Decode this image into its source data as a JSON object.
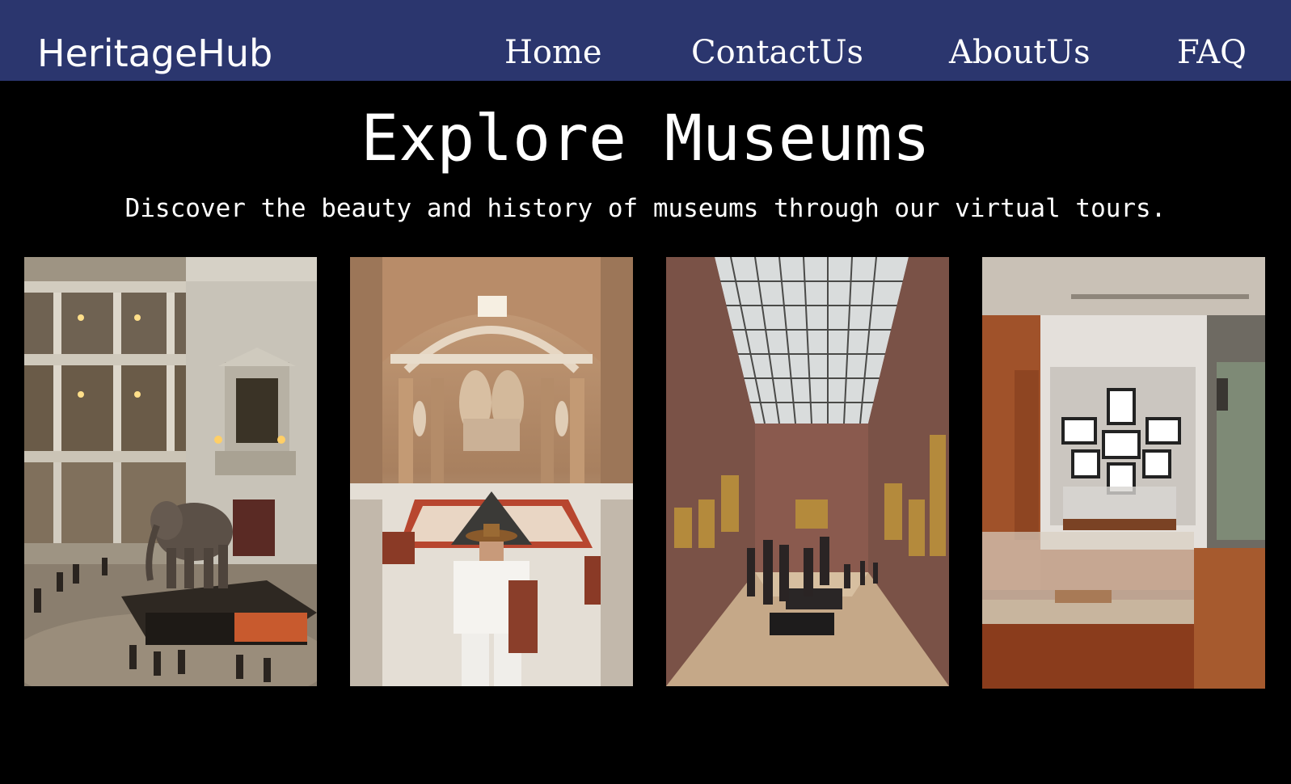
{
  "brand": {
    "name": "HeritageHub"
  },
  "nav": {
    "links": [
      {
        "label": "Home"
      },
      {
        "label": "ContactUs"
      },
      {
        "label": "AboutUs"
      },
      {
        "label": "FAQ"
      }
    ]
  },
  "hero": {
    "title": "Explore Museums",
    "subtitle": "Discover the beauty and history of museums through our virtual tours."
  },
  "gallery": {
    "images": [
      {
        "icon": "museum-rotunda-elephant-photo"
      },
      {
        "icon": "egyptian-museum-hall-photo"
      },
      {
        "icon": "skylit-painting-gallery-photo"
      },
      {
        "icon": "framed-prints-exhibit-photo"
      }
    ]
  },
  "colors": {
    "navbar": "#2b366e",
    "background": "#000000",
    "text": "#ffffff"
  }
}
